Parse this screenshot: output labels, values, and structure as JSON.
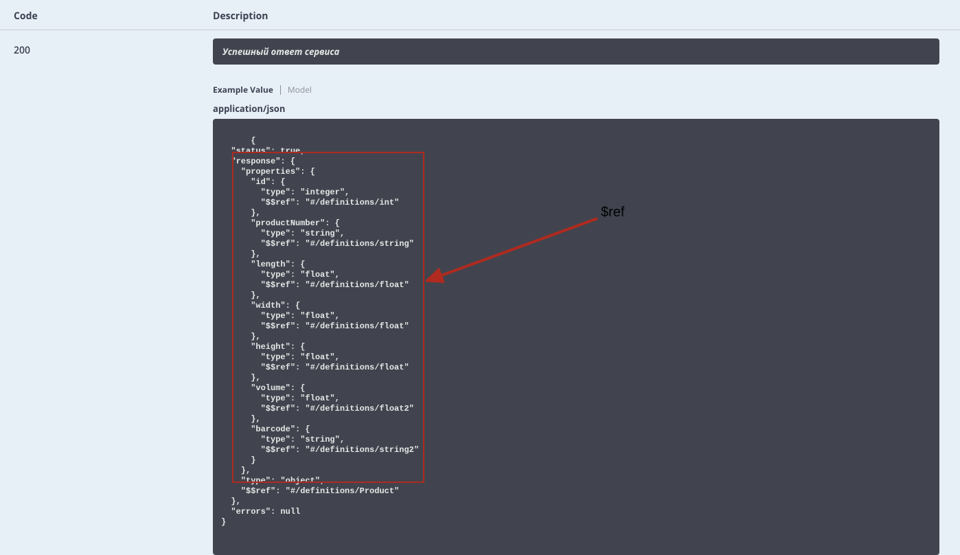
{
  "headers": {
    "code": "Code",
    "description": "Description"
  },
  "row": {
    "code": "200",
    "desc_banner": "Успешный ответ сервиса"
  },
  "tabs": {
    "active": "Example Value",
    "inactive": "Model"
  },
  "content_type": "application/json",
  "json_body": "{\n  \"status\": true,\n  \"response\": {\n    \"properties\": {\n      \"id\": {\n        \"type\": \"integer\",\n        \"$$ref\": \"#/definitions/int\"\n      },\n      \"productNumber\": {\n        \"type\": \"string\",\n        \"$$ref\": \"#/definitions/string\"\n      },\n      \"length\": {\n        \"type\": \"float\",\n        \"$$ref\": \"#/definitions/float\"\n      },\n      \"width\": {\n        \"type\": \"float\",\n        \"$$ref\": \"#/definitions/float\"\n      },\n      \"height\": {\n        \"type\": \"float\",\n        \"$$ref\": \"#/definitions/float\"\n      },\n      \"volume\": {\n        \"type\": \"float\",\n        \"$$ref\": \"#/definitions/float2\"\n      },\n      \"barcode\": {\n        \"type\": \"string\",\n        \"$$ref\": \"#/definitions/string2\"\n      }\n    },\n    \"type\": \"object\",\n    \"$$ref\": \"#/definitions/Product\"\n  },\n  \"errors\": null\n}",
  "annotation": {
    "label": "$ref"
  }
}
